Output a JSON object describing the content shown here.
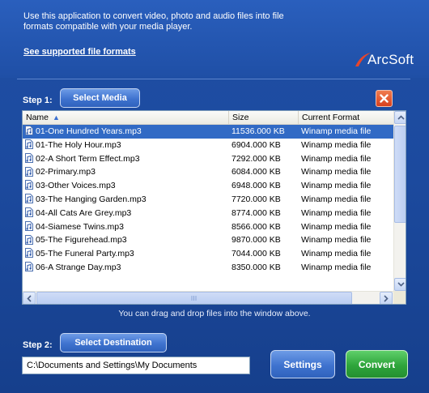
{
  "intro": {
    "line1": "Use this application to convert video, photo and audio files into file",
    "line2": "formats compatible with your media player.",
    "supported_link": "See supported file formats"
  },
  "brand": {
    "logo_text": "ArcSoft"
  },
  "step1": {
    "label": "Step 1:",
    "button": "Select Media"
  },
  "list": {
    "columns": {
      "name": "Name",
      "size": "Size",
      "format": "Current Format"
    },
    "rows": [
      {
        "name": "01-One Hundred Years.mp3",
        "size": "11536.000 KB",
        "format": "Winamp media file"
      },
      {
        "name": "01-The Holy Hour.mp3",
        "size": "6904.000 KB",
        "format": "Winamp media file"
      },
      {
        "name": "02-A Short Term Effect.mp3",
        "size": "7292.000 KB",
        "format": "Winamp media file"
      },
      {
        "name": "02-Primary.mp3",
        "size": "6084.000 KB",
        "format": "Winamp media file"
      },
      {
        "name": "03-Other Voices.mp3",
        "size": "6948.000 KB",
        "format": "Winamp media file"
      },
      {
        "name": "03-The Hanging Garden.mp3",
        "size": "7720.000 KB",
        "format": "Winamp media file"
      },
      {
        "name": "04-All Cats Are Grey.mp3",
        "size": "8774.000 KB",
        "format": "Winamp media file"
      },
      {
        "name": "04-Siamese Twins.mp3",
        "size": "8566.000 KB",
        "format": "Winamp media file"
      },
      {
        "name": "05-The Figurehead.mp3",
        "size": "9870.000 KB",
        "format": "Winamp media file"
      },
      {
        "name": "05-The Funeral Party.mp3",
        "size": "7044.000 KB",
        "format": "Winamp media file"
      },
      {
        "name": "06-A Strange Day.mp3",
        "size": "8350.000 KB",
        "format": "Winamp media file"
      }
    ],
    "selected_index": 0
  },
  "drag_hint": "You can drag and drop files into the window above.",
  "step2": {
    "label": "Step 2:",
    "button": "Select Destination"
  },
  "destination": {
    "path": "C:\\Documents and Settings\\My Documents"
  },
  "actions": {
    "settings": "Settings",
    "convert": "Convert"
  },
  "colors": {
    "background": "#1f4fa6",
    "button_blue": "#3f73cf",
    "convert_green": "#2ea53b",
    "close_red": "#d8401e",
    "selection": "#316ac5"
  }
}
